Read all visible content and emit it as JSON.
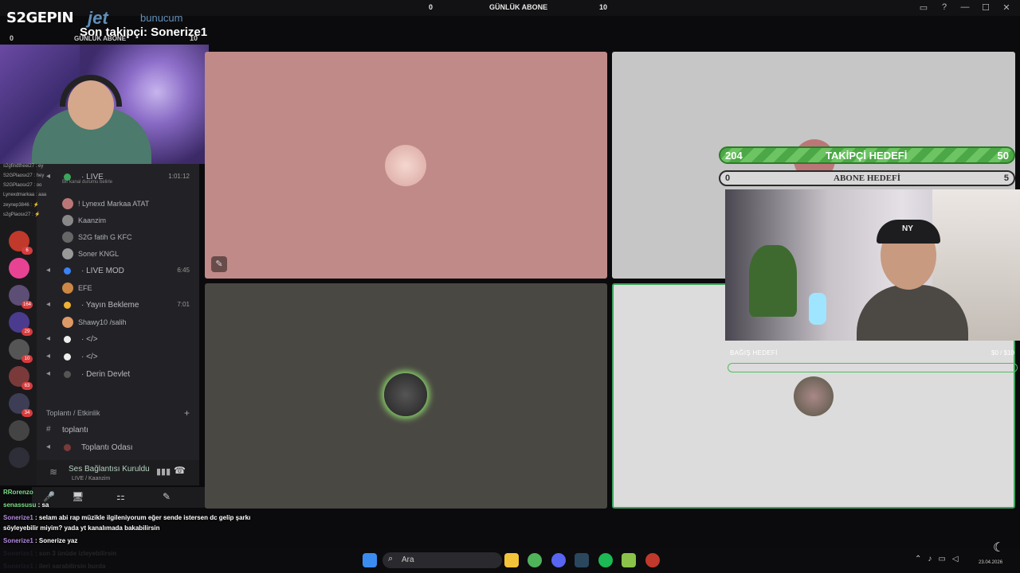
{
  "window": {
    "controls": [
      "▭",
      "?",
      "—",
      "☐",
      "✕"
    ]
  },
  "goal_strip": {
    "left": "0",
    "center": "GÜNLÜK ABONE",
    "right": "10"
  },
  "header": {
    "brand": "S2GEPIN",
    "sponsor": "jet",
    "sponsor_suffix": "bunucum",
    "last_follower": "Son takipçi: Sonerize1",
    "small_left": "0",
    "small_center": "GÜNLÜK ABONE",
    "small_right": "10"
  },
  "sidebar": {
    "servers": [
      {
        "color": "#c0392b",
        "badge": "6"
      },
      {
        "color": "#e84393",
        "badge": ""
      },
      {
        "color": "#5d4e75",
        "badge": "164"
      },
      {
        "color": "#4a3b8f",
        "badge": "29"
      },
      {
        "color": "#555",
        "badge": "10"
      },
      {
        "color": "#7a3a3a",
        "badge": "63"
      },
      {
        "color": "#3d3d55",
        "badge": "34"
      },
      {
        "color": "#444",
        "badge": ""
      },
      {
        "color": "#2e2e38",
        "badge": ""
      }
    ],
    "channels": [
      {
        "type": "voice",
        "dot": "#3ba55c",
        "name": "LIVE",
        "time": "1:01:12"
      },
      {
        "type": "sub",
        "text": "Bir kanal durumu belirle"
      },
      {
        "type": "user",
        "color": "#b77",
        "name": "! Lynexd Markaa",
        "tag": "ATAT"
      },
      {
        "type": "user",
        "color": "#888",
        "name": "Kaanzim",
        "tag": ""
      },
      {
        "type": "user",
        "color": "#666",
        "name": "S2G fatih G",
        "tag": "KFC"
      },
      {
        "type": "user",
        "color": "#999",
        "name": "Soner",
        "tag": "KNGL"
      },
      {
        "type": "voice",
        "dot": "#3b82f6",
        "name": "LIVE MOD",
        "time": "6:45"
      },
      {
        "type": "user",
        "color": "#c84",
        "name": "EFE",
        "tag": ""
      },
      {
        "type": "voice",
        "dot": "#f0b232",
        "name": "Yayın Bekleme",
        "time": "7:01"
      },
      {
        "type": "user",
        "color": "#d96",
        "name": "Shawy10 /salih",
        "tag": ""
      },
      {
        "type": "voice",
        "dot": "#eee",
        "name": "</>",
        "time": ""
      },
      {
        "type": "voice",
        "dot": "#eee",
        "name": "</>",
        "time": ""
      },
      {
        "type": "voice",
        "dot": "#555",
        "name": "Derin Devlet",
        "time": ""
      }
    ],
    "section": "Toplantı / Etkinlik",
    "section_plus": "+",
    "text_channel": "toplantı",
    "meeting_channel": "Toplantı Odası",
    "voice_status": "Ses Bağlantısı Kuruldu",
    "voice_sub": "LIVE / Kaanzim",
    "overlay_chat": [
      "s2gfindtheei27 : ey",
      "S2GPlaosx27 : hey",
      "S2GPlaosx27 : oo",
      "Lynexdmarkaa : aaa",
      "zeynep3846 : ⚡",
      "s2gPlaosx27 : ⚡"
    ]
  },
  "bottom_controls": [
    "🎤",
    "🖥",
    "⚏",
    "✎"
  ],
  "goals": {
    "follow": {
      "left": "204",
      "label": "TAKİPÇİ HEDEFİ",
      "right": "50",
      "progress": 1.0
    },
    "sub": {
      "left": "0",
      "label": "ABONE HEDEFİ",
      "right": "5",
      "progress": 0.0
    },
    "donate": {
      "label": "BAĞIŞ HEDEFİ",
      "amount": "$0 / $10",
      "progress": 0.0
    }
  },
  "chat": [
    {
      "user": "RRorenzo",
      "text": "",
      "user_color": "#7ee08a"
    },
    {
      "user": "senassusu",
      "text": ": sa",
      "user_color": "#7ee08a"
    },
    {
      "user": "Sonerize1",
      "text": ": selam abi rap müzikle ilgileniyorum eğer sende istersen dc gelip şarkı",
      "user_color": "#b58be0"
    },
    {
      "user": "",
      "text": "söyleyebilir miyim? yada yt kanalımada bakabilirsin",
      "user_color": "#b58be0"
    },
    {
      "user": "Sonerize1",
      "text": ": Sonerize yaz",
      "user_color": "#b58be0"
    },
    {
      "user": "Sonerize1",
      "text": ": son 3 ünüde izleyebilirsin",
      "user_color": "#b58be0"
    },
    {
      "user": "Sonerize1",
      "text": ": ileri sarabilirsin burda",
      "user_color": "#b58be0"
    }
  ],
  "taskbar": {
    "search_placeholder": "Ara",
    "clock": "23.04.2026",
    "apps": [
      {
        "name": "start",
        "color": "#3b8cf0"
      },
      {
        "name": "explorer",
        "color": "#f3c33a"
      },
      {
        "name": "chrome",
        "color": "#4fb35a"
      },
      {
        "name": "discord",
        "color": "#5865f2"
      },
      {
        "name": "steam",
        "color": "#2a475e"
      },
      {
        "name": "spotify",
        "color": "#1db954"
      },
      {
        "name": "play",
        "color": "#8bc34a"
      },
      {
        "name": "obs",
        "color": "#c0392b"
      }
    ]
  }
}
